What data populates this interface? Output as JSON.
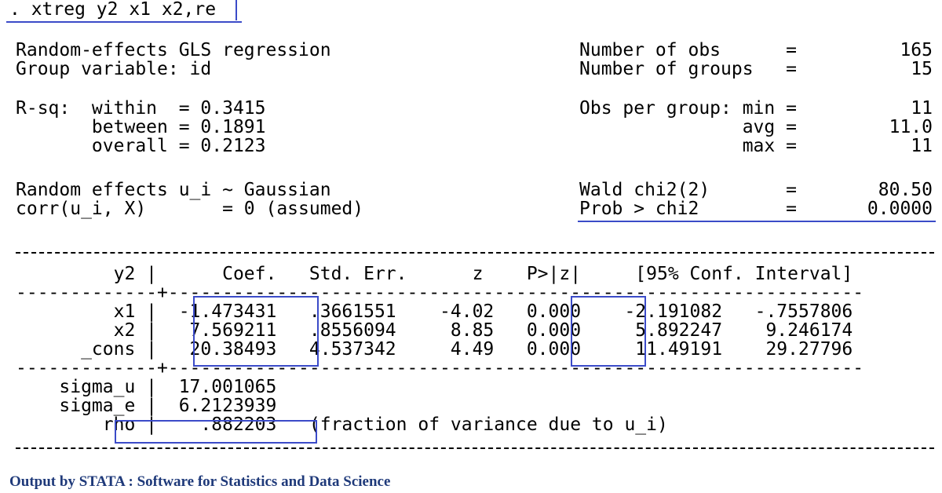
{
  "command": ". xtreg y2 x1 x2,re",
  "header": {
    "left": [
      "Random-effects GLS regression",
      "Group variable: id",
      "R-sq:  within  = 0.3415",
      "       between = 0.1891",
      "       overall = 0.2123",
      "Random effects u_i ~ Gaussian",
      "corr(u_i, X)       = 0 (assumed)"
    ],
    "right_labels": [
      "Number of obs      =",
      "Number of groups   =",
      "Obs per group: min =",
      "               avg =",
      "               max =",
      "Wald chi2(2)       =",
      "Prob > chi2        ="
    ],
    "right_values": [
      "165",
      "15",
      "11",
      "11.0",
      "11",
      "80.50",
      "0.0000"
    ]
  },
  "table": {
    "header": "         y2 |      Coef.   Std. Err.      z    P>|z|     [95% Conf. Interval]",
    "sep": "-------------+----------------------------------------------------------------",
    "rows": [
      "         x1 |  -1.473431   .3661551    -4.02   0.000    -2.191082   -.7557806",
      "         x2 |   7.569211   .8556094     8.85   0.000     5.892247    9.246174",
      "      _cons |   20.38493   4.537342     4.49   0.000     11.49191    29.27796"
    ],
    "extra": [
      "    sigma_u |  17.001065",
      "    sigma_e |  6.2123939",
      "        rho |    .882203   (fraction of variance due to u_i)"
    ]
  },
  "caption": "Output by STATA : Software for Statistics and Data Science",
  "colors": {
    "highlight": "#3b4bc8",
    "caption": "#1f3a7a",
    "text": "#000000"
  }
}
